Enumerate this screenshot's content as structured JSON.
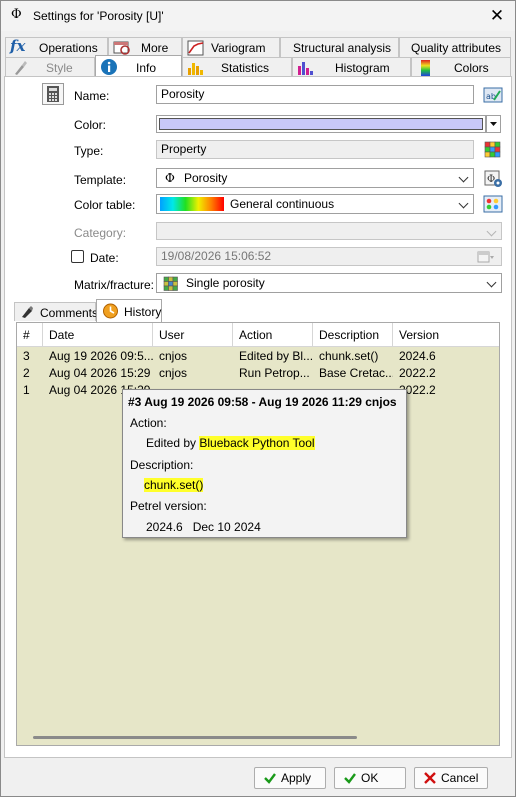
{
  "window": {
    "title": "Settings for 'Porosity [U]'"
  },
  "tabs_row1": [
    {
      "label": "Operations",
      "icon": "fx-icon"
    },
    {
      "label": "More",
      "icon": "magnifier-icon"
    },
    {
      "label": "Variogram",
      "icon": "variogram-icon"
    },
    {
      "label": "Structural analysis"
    },
    {
      "label": "Quality attributes"
    }
  ],
  "tabs_row2": [
    {
      "label": "Style",
      "icon": "brush-icon"
    },
    {
      "label": "Info",
      "icon": "info-icon",
      "active": true
    },
    {
      "label": "Statistics",
      "icon": "statistics-icon"
    },
    {
      "label": "Histogram",
      "icon": "histogram-icon"
    },
    {
      "label": "Colors",
      "icon": "colors-icon"
    }
  ],
  "info": {
    "name_label": "Name:",
    "name_value": "Porosity",
    "color_label": "Color:",
    "color_value": "#c8c8f8",
    "type_label": "Type:",
    "type_value": "Property",
    "template_label": "Template:",
    "template_value": "Porosity",
    "template_symbol": "Φ",
    "colortable_label": "Color table:",
    "colortable_value": "General continuous",
    "category_label": "Category:",
    "date_label": "Date:",
    "date_value": "19/08/2026 15:06:52",
    "matrix_label": "Matrix/fracture:",
    "matrix_value": "Single porosity"
  },
  "subtabs": [
    {
      "label": "Comments",
      "icon": "comments-icon"
    },
    {
      "label": "History",
      "icon": "history-icon",
      "active": true
    }
  ],
  "history": {
    "columns": [
      "#",
      "Date",
      "User",
      "Action",
      "Description",
      "Version"
    ],
    "rows": [
      [
        "3",
        "Aug 19 2026 09:5...",
        "cnjos",
        "Edited by Bl...",
        "chunk.set()",
        "2024.6"
      ],
      [
        "2",
        "Aug 04 2026 15:29",
        "cnjos",
        "Run Petrop...",
        "Base Cretac...",
        "2022.2"
      ],
      [
        "1",
        "Aug 04 2026 15:29",
        "",
        "",
        "",
        "2022.2"
      ]
    ]
  },
  "tooltip": {
    "header": "#3  Aug 19 2026 09:58 - Aug 19 2026 11:29  cnjos",
    "action_label": "Action:",
    "action_prefix": "Edited by ",
    "action_highlight": "Blueback Python Tool",
    "description_label": "Description:",
    "description_value": "chunk.set()",
    "version_label": "Petrel version:",
    "version_value": "2024.6   Dec 10 2024"
  },
  "buttons": {
    "apply": "Apply",
    "ok": "OK",
    "cancel": "Cancel"
  }
}
